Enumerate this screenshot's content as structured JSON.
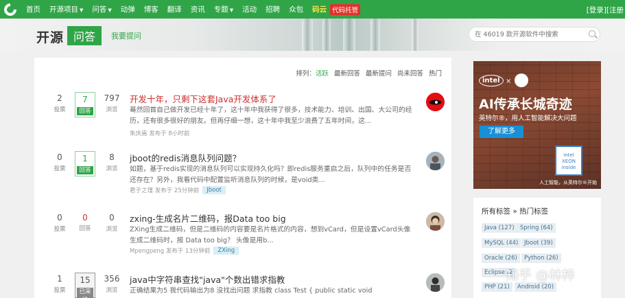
{
  "nav": {
    "items": [
      "首页",
      "开源项目",
      "问答",
      "动弹",
      "博客",
      "翻译",
      "资讯",
      "专题",
      "活动",
      "招聘",
      "众包"
    ],
    "dropdown_items": [
      1,
      2,
      7
    ],
    "code_cloud": "码云",
    "code_hosting": "代码托管",
    "login": "[登录][注册"
  },
  "header": {
    "brand": "开源",
    "section": "问答",
    "ask_link": "我要提问",
    "search_placeholder": "在 46019 款开源软件中搜索"
  },
  "sort": {
    "label": "排列：",
    "options": [
      "活跃",
      "最新回答",
      "最新提问",
      "尚未回答",
      "热门"
    ],
    "active_index": 0
  },
  "questions": [
    {
      "votes": "2",
      "votes_label": "投票",
      "answers": "7",
      "answers_label": "回答",
      "answer_state": "answered",
      "views": "797",
      "views_label": "浏览",
      "title": "开发十年，只剩下这套Java开发体系了",
      "desc": "蓦然回首自己做开发已经十年了，这十年中我获得了很多，技术能力、培训、出国、大公司的经历，还有很多很好的朋友。但再仔细一想，这十年中我至少浪费了五年时间，这...",
      "meta": "朱庆嵩 发布于 8小时前",
      "tag": ""
    },
    {
      "votes": "0",
      "votes_label": "投票",
      "answers": "1",
      "answers_label": "回答",
      "answer_state": "answered",
      "views": "8",
      "views_label": "浏览",
      "title": "jboot的redis消息队列问题？",
      "desc": "如题，基于redis实现的消息队列可以实现持久化吗？即redis服务重启之后，队列中的任务是否还存在？另外，我看代码中配置监听消息队列的时候，是void类...",
      "meta": "君子之瑾 发布于 25分钟前",
      "tag": "Jboot"
    },
    {
      "votes": "0",
      "votes_label": "投票",
      "answers": "0",
      "answers_label": "回答",
      "answer_state": "zero",
      "views": "0",
      "views_label": "浏览",
      "title": "zxing-生成名片二维码，报Data too big",
      "desc": "ZXing生成二维码，但是二维码的内容要是名片格式的内容，想到vCard，但是设置vCard头像生成二维码时，报 Data too big？ 头像是用b...",
      "meta": "Mpengpeng 发布于 13分钟前",
      "tag": "ZXing"
    },
    {
      "votes": "1",
      "votes_label": "投票",
      "answers": "15",
      "answers_label": "已采纳",
      "answer_state": "adopted",
      "views": "356",
      "views_label": "浏览",
      "title": "java中字符串查找\"java\"个数出错求指教",
      "desc": "正确结果为5 我代码输出为8 没找出问题 求指教 class Test {       public static void main(String[]",
      "meta": "",
      "tag": ""
    }
  ],
  "ad": {
    "brand": "intel",
    "times": "×",
    "headline": "AI传承长城奇迹",
    "sub": "英特尔®，用人工智能解决大问题",
    "button": "了解更多",
    "chip": "intel XEON inside",
    "footer": "人工智能，从英特尔®开始"
  },
  "tags": {
    "title": "所有标签 » 热门标签",
    "items": [
      "Java (127)",
      "Spring (64)",
      "MySQL (44)",
      "Jboot (39)",
      "Oracle (26)",
      "Python (26)",
      "Eclipse (2",
      "PHP (21)",
      "Android (20)"
    ]
  },
  "watermark": "知乎 @林梓",
  "colors": {
    "brand_green": "#2fa548",
    "title_red": "#c9302c",
    "tag_bg": "#d9eef5"
  }
}
